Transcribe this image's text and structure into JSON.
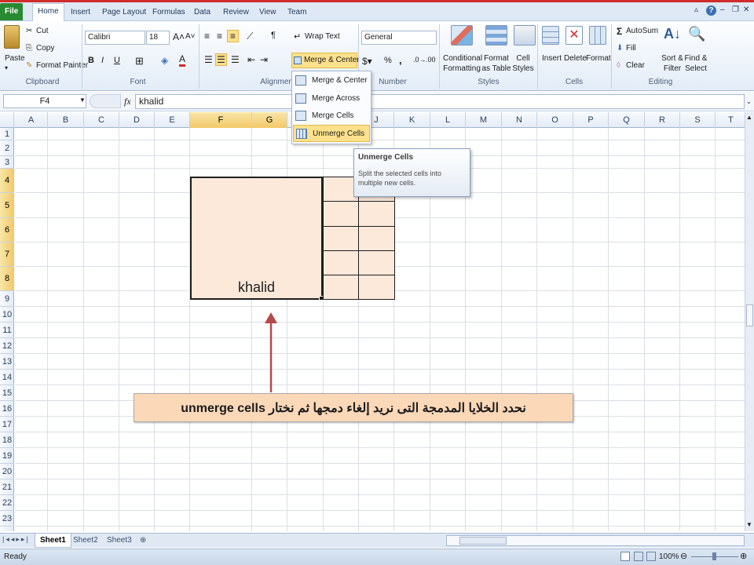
{
  "tabs": {
    "file": "File",
    "items": [
      "Home",
      "Insert",
      "Page Layout",
      "Formulas",
      "Data",
      "Review",
      "View",
      "Team"
    ],
    "active": "Home"
  },
  "ribbon": {
    "clipboard": {
      "paste": "Paste",
      "cut": "Cut",
      "copy": "Copy",
      "format_painter": "Format Painter",
      "label": "Clipboard"
    },
    "font": {
      "name": "Calibri",
      "size": "18",
      "bold": "B",
      "italic": "I",
      "underline": "U",
      "label": "Font"
    },
    "alignment": {
      "wrap_text": "Wrap Text",
      "merge_center": "Merge & Center",
      "label": "Alignment"
    },
    "number": {
      "format": "General",
      "label": "Number",
      "percent": "%",
      "comma": ","
    },
    "styles": {
      "conditional": "Conditional Formatting",
      "format_table": "Format as Table",
      "cell_styles": "Cell Styles",
      "label": "Styles"
    },
    "cells": {
      "insert": "Insert",
      "delete": "Delete",
      "format": "Format",
      "label": "Cells"
    },
    "editing": {
      "autosum": "AutoSum",
      "fill": "Fill",
      "clear": "Clear",
      "sort": "Sort & Filter",
      "find": "Find & Select",
      "label": "Editing"
    }
  },
  "formula_bar": {
    "name_box": "F4",
    "fx": "fx",
    "content": "khalid"
  },
  "merge_menu": {
    "items": [
      "Merge & Center",
      "Merge Across",
      "Merge Cells",
      "Unmerge Cells"
    ],
    "highlighted": "Unmerge Cells"
  },
  "tooltip": {
    "title": "Unmerge Cells",
    "body": "Split the selected cells into multiple new cells."
  },
  "grid": {
    "columns": [
      "A",
      "B",
      "C",
      "D",
      "E",
      "F",
      "G",
      "H",
      "I",
      "J",
      "K",
      "L",
      "M",
      "N",
      "O",
      "P",
      "Q",
      "R",
      "S",
      "T"
    ],
    "rows": [
      "1",
      "2",
      "3",
      "4",
      "5",
      "6",
      "7",
      "8",
      "9",
      "10",
      "11",
      "12",
      "13",
      "14",
      "15",
      "16",
      "17",
      "18",
      "19",
      "20",
      "21",
      "22",
      "23"
    ],
    "merged_value": "khalid",
    "fill_color": "#fce9da"
  },
  "callout": {
    "text": "نحدد الخلايا المدمجة التى نريد إلغاء دمجها ثم نختار unmerge cells"
  },
  "sheets": [
    "Sheet1",
    "Sheet2",
    "Sheet3"
  ],
  "status": {
    "ready": "Ready",
    "zoom": "100%"
  }
}
